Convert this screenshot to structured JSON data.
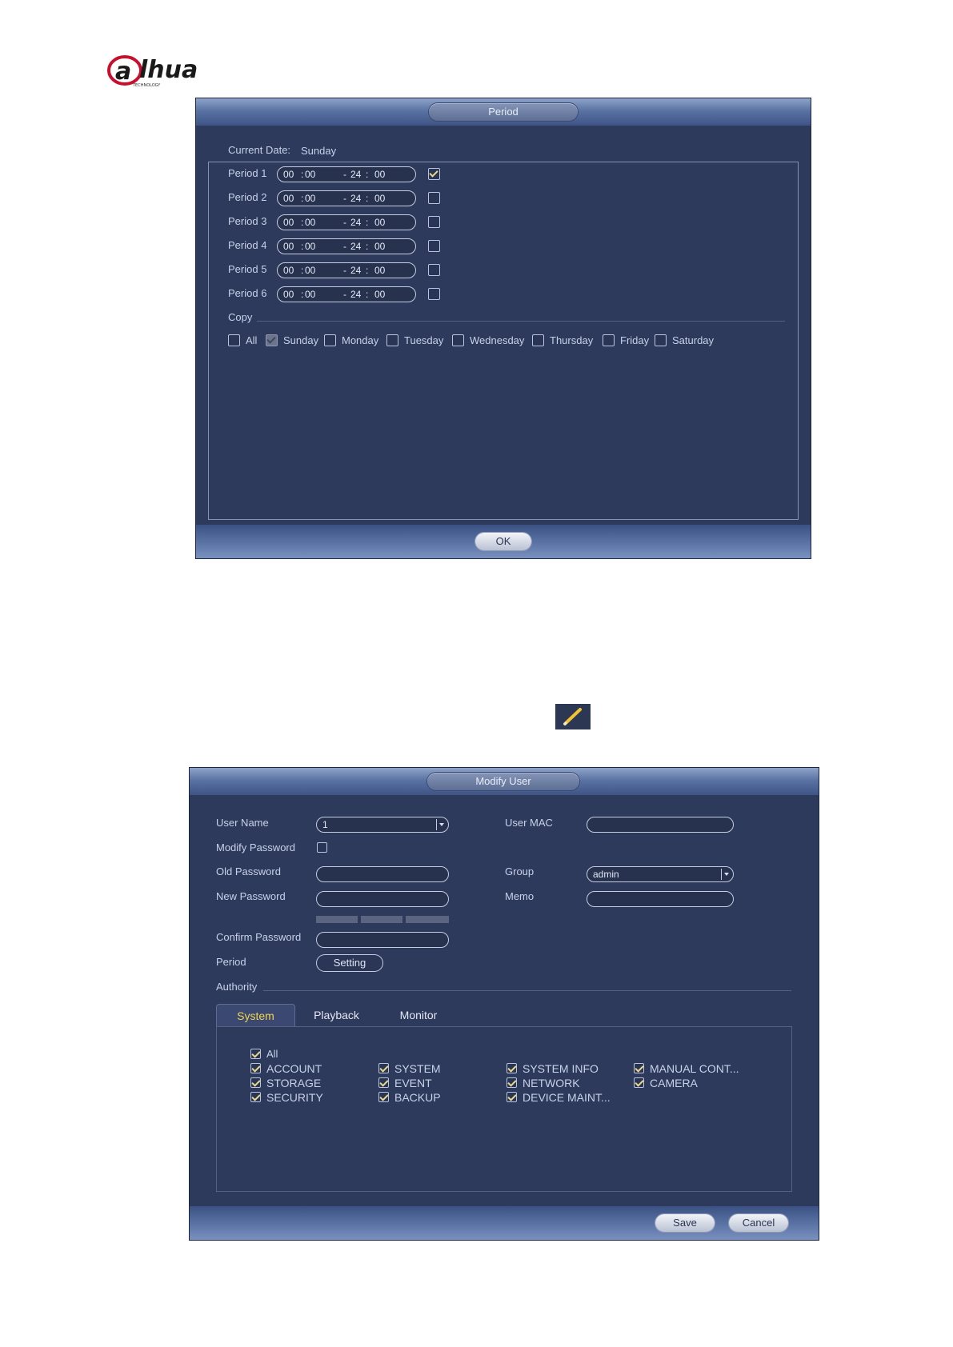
{
  "logo": {
    "brand": "alhua",
    "sub": "TECHNOLOGY"
  },
  "period_dialog": {
    "title": "Period",
    "current_date_label": "Current Date:",
    "current_date_value": "Sunday",
    "periods": [
      {
        "label": "Period 1",
        "start_h": "00",
        "start_m": "00",
        "end_h": "24",
        "end_m": "00",
        "checked": true
      },
      {
        "label": "Period 2",
        "start_h": "00",
        "start_m": "00",
        "end_h": "24",
        "end_m": "00",
        "checked": false
      },
      {
        "label": "Period 3",
        "start_h": "00",
        "start_m": "00",
        "end_h": "24",
        "end_m": "00",
        "checked": false
      },
      {
        "label": "Period 4",
        "start_h": "00",
        "start_m": "00",
        "end_h": "24",
        "end_m": "00",
        "checked": false
      },
      {
        "label": "Period 5",
        "start_h": "00",
        "start_m": "00",
        "end_h": "24",
        "end_m": "00",
        "checked": false
      },
      {
        "label": "Period 6",
        "start_h": "00",
        "start_m": "00",
        "end_h": "24",
        "end_m": "00",
        "checked": false
      }
    ],
    "copy_label": "Copy",
    "copy_days": [
      {
        "label": "All",
        "state": "off"
      },
      {
        "label": "Sunday",
        "state": "dim"
      },
      {
        "label": "Monday",
        "state": "off"
      },
      {
        "label": "Tuesday",
        "state": "off"
      },
      {
        "label": "Wednesday",
        "state": "off"
      },
      {
        "label": "Thursday",
        "state": "off"
      },
      {
        "label": "Friday",
        "state": "off"
      },
      {
        "label": "Saturday",
        "state": "off"
      }
    ],
    "ok_label": "OK"
  },
  "modify_user": {
    "title": "Modify User",
    "user_name_label": "User Name",
    "user_name_value": "1",
    "modify_password_label": "Modify Password",
    "old_password_label": "Old Password",
    "new_password_label": "New Password",
    "confirm_password_label": "Confirm Password",
    "period_label": "Period",
    "setting_label": "Setting",
    "user_mac_label": "User MAC",
    "group_label": "Group",
    "group_value": "admin",
    "memo_label": "Memo",
    "authority_label": "Authority",
    "tabs": [
      "System",
      "Playback",
      "Monitor"
    ],
    "all_label": "All",
    "permissions": [
      [
        "ACCOUNT",
        "STORAGE",
        "SECURITY"
      ],
      [
        "SYSTEM",
        "EVENT",
        "BACKUP"
      ],
      [
        "SYSTEM INFO",
        "NETWORK",
        "DEVICE MAINT..."
      ],
      [
        "MANUAL CONT...",
        "CAMERA"
      ]
    ],
    "save_label": "Save",
    "cancel_label": "Cancel"
  },
  "colors": {
    "dialog_bg": "#2e3a5c",
    "active_tab_text": "#f0d64a",
    "check": "#e8d98a"
  },
  "icons": [
    "pencil-icon",
    "dropdown-arrow-icon",
    "checkbox-icon"
  ]
}
